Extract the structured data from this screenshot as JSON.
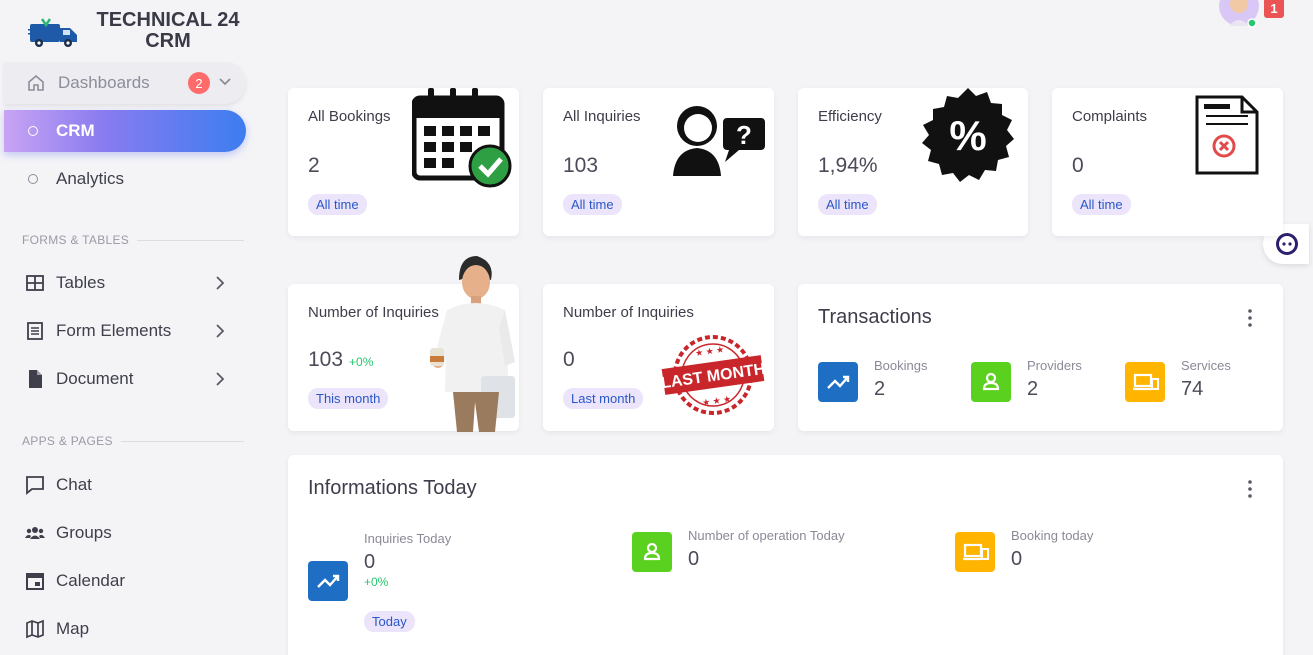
{
  "brand": {
    "line1": "TECHNICAL 24",
    "line2": "CRM"
  },
  "header": {
    "notification_count": "1"
  },
  "sidebar": {
    "dashboards": {
      "label": "Dashboards",
      "badge": "2"
    },
    "items_top": [
      {
        "label": "CRM",
        "active": true
      },
      {
        "label": "Analytics",
        "active": false
      }
    ],
    "section_forms": "FORMS & TABLES",
    "forms_items": [
      {
        "label": "Tables",
        "icon": "table-icon"
      },
      {
        "label": "Form Elements",
        "icon": "form-icon"
      },
      {
        "label": "Document",
        "icon": "document-icon"
      }
    ],
    "section_apps": "APPS & PAGES",
    "apps_items": [
      {
        "label": "Chat",
        "icon": "chat-icon"
      },
      {
        "label": "Groups",
        "icon": "groups-icon"
      },
      {
        "label": "Calendar",
        "icon": "calendar-icon"
      },
      {
        "label": "Map",
        "icon": "map-icon"
      }
    ]
  },
  "cards": [
    {
      "title": "All Bookings",
      "value": "2",
      "pill": "All time",
      "icon": "calendar-check-icon"
    },
    {
      "title": "All Inquiries",
      "value": "103",
      "pill": "All time",
      "icon": "person-question-icon"
    },
    {
      "title": "Efficiency",
      "value": "1,94%",
      "pill": "All time",
      "icon": "percent-badge-icon"
    },
    {
      "title": "Complaints",
      "value": "0",
      "pill": "All time",
      "icon": "document-cancel-icon"
    }
  ],
  "inquiries_this_month": {
    "title": "Number of Inquiries",
    "value": "103",
    "change": "+0%",
    "pill": "This month"
  },
  "inquiries_last_month": {
    "title": "Number of Inquiries",
    "value": "0",
    "pill": "Last month",
    "stamp": "LAST MONTH"
  },
  "transactions": {
    "title": "Transactions",
    "stats": [
      {
        "label": "Bookings",
        "value": "2",
        "color": "#1e6fc4",
        "icon": "trending-up-icon"
      },
      {
        "label": "Providers",
        "value": "2",
        "color": "#5ad01f",
        "icon": "user-icon"
      },
      {
        "label": "Services",
        "value": "74",
        "color": "#ffb400",
        "icon": "devices-icon"
      }
    ]
  },
  "informations_today": {
    "title": "Informations Today",
    "inquiries": {
      "label": "Inquiries Today",
      "value": "0",
      "change": "+0%",
      "pill": "Today",
      "color": "#1e6fc4"
    },
    "operations": {
      "label": "Number of operation Today",
      "value": "0",
      "color": "#5ad01f"
    },
    "bookings": {
      "label": "Booking today",
      "value": "0",
      "color": "#ffb400"
    }
  },
  "colors": {
    "accent": "#3c7df0",
    "pill_bg": "#ebe4fb",
    "pill_text": "#2a57c8",
    "positive": "#28c76f"
  }
}
